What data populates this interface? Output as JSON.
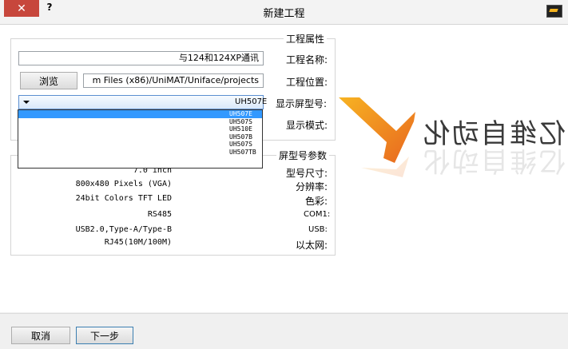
{
  "window": {
    "title": "新建工程",
    "close_glyph": "✕",
    "help_glyph": "?"
  },
  "project_group": {
    "legend": "工程属性",
    "name_label": "工程名称:",
    "name_value": "与124和124XP通讯",
    "location_label": "工程位置:",
    "location_value": "m Files (x86)/UniMAT/Uniface/projects",
    "browse_label": "浏览",
    "model_label": "显示屏型号:",
    "model_value": "UH507E",
    "mode_label": "显示模式:",
    "model_options": [
      "UH507E",
      "UH507S",
      "UH510E",
      "UH507B",
      "UH507S",
      "UH507TB"
    ]
  },
  "spec_group": {
    "legend": "屏型号参数",
    "rows": [
      {
        "label": "型号尺寸:",
        "value": "7.0 inch"
      },
      {
        "label": "分辨率:",
        "value": "800x480 Pixels (VGA)"
      },
      {
        "label": "色彩:",
        "value": "24bit Colors TFT LED"
      },
      {
        "label": "COM1:",
        "value": "RS485"
      },
      {
        "label": "USB:",
        "value": "USB2.0,Type-A/Type-B"
      },
      {
        "label": "以太网:",
        "value": "RJ45(10M/100M)"
      }
    ]
  },
  "logo": {
    "text": "亿维自动化",
    "colors": [
      "#f7b322",
      "#e8661f"
    ]
  },
  "buttons": {
    "cancel": "取消",
    "next": "下一步"
  }
}
